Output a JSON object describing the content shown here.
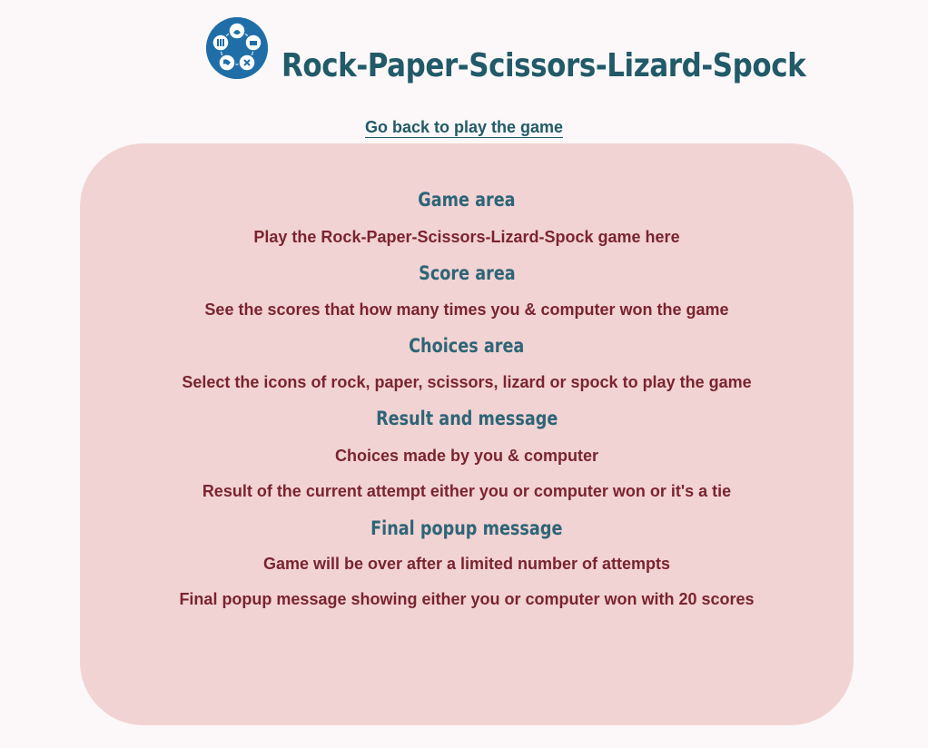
{
  "header": {
    "logo_icon": "rock-paper-scissors-lizard-spock-logo",
    "title": "Rock-Paper-Scissors-Lizard-Spock"
  },
  "nav": {
    "back_link": "Go back to play the game"
  },
  "sections": [
    {
      "title": "Game area",
      "lines": [
        "Play the Rock-Paper-Scissors-Lizard-Spock game here"
      ]
    },
    {
      "title": "Score area",
      "lines": [
        "See the scores that how many times you & computer won the game"
      ]
    },
    {
      "title": "Choices area",
      "lines": [
        "Select the icons of rock, paper, scissors, lizard or spock to play the game"
      ]
    },
    {
      "title": "Result and message",
      "lines": [
        "Choices made by you & computer",
        "Result of the current attempt either you or computer won or it's a tie"
      ]
    },
    {
      "title": "Final popup message",
      "lines": [
        "Game will be over after a limited number of attempts",
        "Final popup message showing either you or computer won with 20 scores"
      ]
    }
  ],
  "colors": {
    "background": "#fcf8f9",
    "card": "#f2d3d3",
    "title": "#215a68",
    "heading": "#2e6577",
    "body_text": "#7a2430",
    "logo": "#1f6ea8"
  }
}
